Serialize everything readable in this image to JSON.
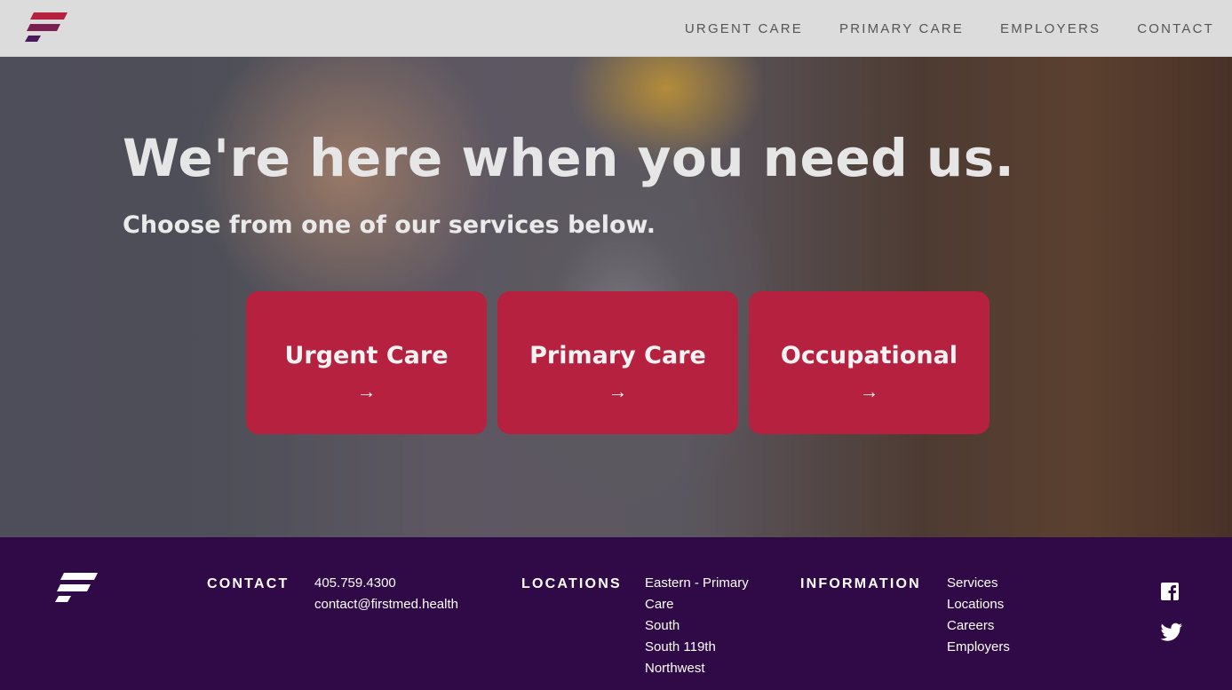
{
  "header": {
    "nav": [
      "URGENT CARE",
      "PRIMARY CARE",
      "EMPLOYERS",
      "CONTACT"
    ]
  },
  "hero": {
    "title": "We're here when you need us.",
    "subtitle": "Choose from one of our services below.",
    "cards": [
      {
        "label": "Urgent Care",
        "arrow": "→"
      },
      {
        "label": "Primary Care",
        "arrow": "→"
      },
      {
        "label": "Occupational",
        "arrow": "→"
      }
    ]
  },
  "footer": {
    "contact": {
      "heading": "CONTACT",
      "phone": "405.759.4300",
      "email": "contact@firstmed.health"
    },
    "locations": {
      "heading": "LOCATIONS",
      "items": [
        "Eastern - Primary Care",
        "South",
        "South 119th",
        "Northwest"
      ]
    },
    "information": {
      "heading": "INFORMATION",
      "items": [
        "Services",
        "Locations",
        "Careers",
        "Employers"
      ]
    },
    "social": [
      "facebook-icon",
      "twitter-icon"
    ]
  },
  "colors": {
    "brand_red": "#b5213f",
    "footer_purple": "#2f0a47",
    "header_bg": "#dcdcdc"
  }
}
